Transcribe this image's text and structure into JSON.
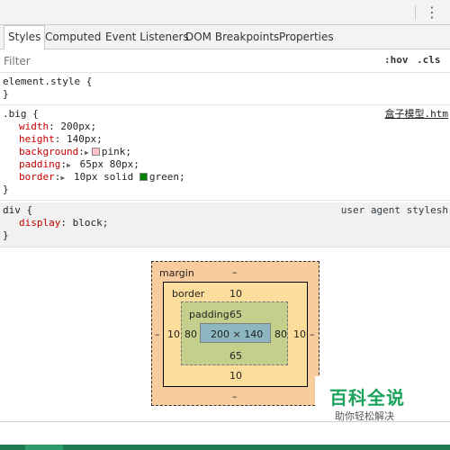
{
  "topbar": {
    "menu_icon": "vertical-ellipsis-icon",
    "menu_glyph": "⋮"
  },
  "tabs": [
    {
      "label": "Styles",
      "active": true
    },
    {
      "label": "Computed",
      "active": false
    },
    {
      "label": "Event Listeners",
      "active": false
    },
    {
      "label": "DOM Breakpoints",
      "active": false
    },
    {
      "label": "Properties",
      "active": false
    }
  ],
  "filter": {
    "placeholder": "Filter",
    "hov": ":hov",
    "cls": ".cls"
  },
  "rules": {
    "element_style": {
      "selector": "element.style {",
      "close": "}"
    },
    "big": {
      "selector": ".big {",
      "source": "盒子模型.htm",
      "close": "}",
      "decls": [
        {
          "prop": "width",
          "value": "200px;"
        },
        {
          "prop": "height",
          "value": "140px;"
        },
        {
          "prop": "background",
          "value": "pink;",
          "swatch": "#ffc0cb"
        },
        {
          "prop": "padding",
          "value": "65px 80px;"
        },
        {
          "prop": "border",
          "value": "10px solid",
          "swatch": "#008000",
          "value2": "green;"
        }
      ]
    },
    "div": {
      "selector": "div {",
      "source": "user agent stylesh",
      "close": "}",
      "decls": [
        {
          "prop": "display",
          "value": "block;"
        }
      ]
    }
  },
  "box_model": {
    "margin": {
      "label": "margin",
      "top": "–",
      "bottom": "–",
      "left": "–",
      "right": "–"
    },
    "border": {
      "label": "border",
      "top": "10",
      "bottom": "10",
      "left": "10",
      "right": "10"
    },
    "padding": {
      "label": "padding",
      "top": "65",
      "bottom": "65",
      "left": "80",
      "right": "80"
    },
    "content": "200 × 140"
  },
  "watermark": {
    "title": "百科全说",
    "subtitle": "助你轻松解决"
  },
  "colors": {
    "margin": "#f9cc9d",
    "border": "#fddd9b",
    "padding": "#c3d08b",
    "content": "#8cb6c0"
  }
}
